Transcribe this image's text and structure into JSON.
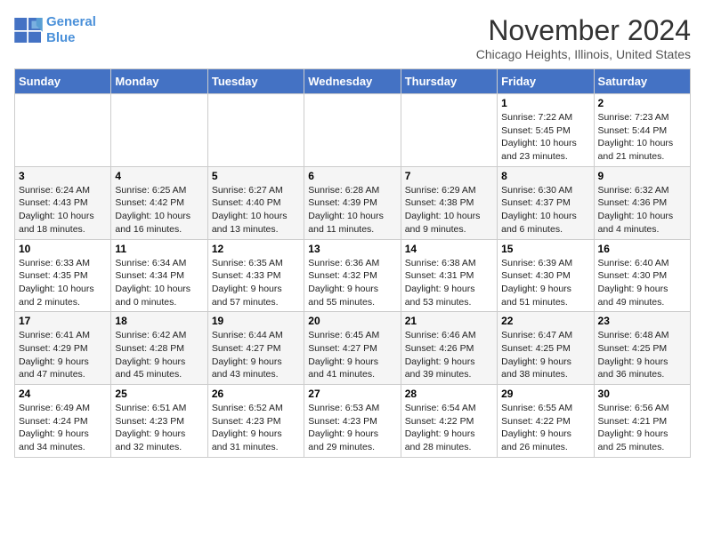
{
  "header": {
    "logo_line1": "General",
    "logo_line2": "Blue",
    "month_title": "November 2024",
    "location": "Chicago Heights, Illinois, United States"
  },
  "weekdays": [
    "Sunday",
    "Monday",
    "Tuesday",
    "Wednesday",
    "Thursday",
    "Friday",
    "Saturday"
  ],
  "weeks": [
    [
      {
        "day": "",
        "info": ""
      },
      {
        "day": "",
        "info": ""
      },
      {
        "day": "",
        "info": ""
      },
      {
        "day": "",
        "info": ""
      },
      {
        "day": "",
        "info": ""
      },
      {
        "day": "1",
        "info": "Sunrise: 7:22 AM\nSunset: 5:45 PM\nDaylight: 10 hours\nand 23 minutes."
      },
      {
        "day": "2",
        "info": "Sunrise: 7:23 AM\nSunset: 5:44 PM\nDaylight: 10 hours\nand 21 minutes."
      }
    ],
    [
      {
        "day": "3",
        "info": "Sunrise: 6:24 AM\nSunset: 4:43 PM\nDaylight: 10 hours\nand 18 minutes."
      },
      {
        "day": "4",
        "info": "Sunrise: 6:25 AM\nSunset: 4:42 PM\nDaylight: 10 hours\nand 16 minutes."
      },
      {
        "day": "5",
        "info": "Sunrise: 6:27 AM\nSunset: 4:40 PM\nDaylight: 10 hours\nand 13 minutes."
      },
      {
        "day": "6",
        "info": "Sunrise: 6:28 AM\nSunset: 4:39 PM\nDaylight: 10 hours\nand 11 minutes."
      },
      {
        "day": "7",
        "info": "Sunrise: 6:29 AM\nSunset: 4:38 PM\nDaylight: 10 hours\nand 9 minutes."
      },
      {
        "day": "8",
        "info": "Sunrise: 6:30 AM\nSunset: 4:37 PM\nDaylight: 10 hours\nand 6 minutes."
      },
      {
        "day": "9",
        "info": "Sunrise: 6:32 AM\nSunset: 4:36 PM\nDaylight: 10 hours\nand 4 minutes."
      }
    ],
    [
      {
        "day": "10",
        "info": "Sunrise: 6:33 AM\nSunset: 4:35 PM\nDaylight: 10 hours\nand 2 minutes."
      },
      {
        "day": "11",
        "info": "Sunrise: 6:34 AM\nSunset: 4:34 PM\nDaylight: 10 hours\nand 0 minutes."
      },
      {
        "day": "12",
        "info": "Sunrise: 6:35 AM\nSunset: 4:33 PM\nDaylight: 9 hours\nand 57 minutes."
      },
      {
        "day": "13",
        "info": "Sunrise: 6:36 AM\nSunset: 4:32 PM\nDaylight: 9 hours\nand 55 minutes."
      },
      {
        "day": "14",
        "info": "Sunrise: 6:38 AM\nSunset: 4:31 PM\nDaylight: 9 hours\nand 53 minutes."
      },
      {
        "day": "15",
        "info": "Sunrise: 6:39 AM\nSunset: 4:30 PM\nDaylight: 9 hours\nand 51 minutes."
      },
      {
        "day": "16",
        "info": "Sunrise: 6:40 AM\nSunset: 4:30 PM\nDaylight: 9 hours\nand 49 minutes."
      }
    ],
    [
      {
        "day": "17",
        "info": "Sunrise: 6:41 AM\nSunset: 4:29 PM\nDaylight: 9 hours\nand 47 minutes."
      },
      {
        "day": "18",
        "info": "Sunrise: 6:42 AM\nSunset: 4:28 PM\nDaylight: 9 hours\nand 45 minutes."
      },
      {
        "day": "19",
        "info": "Sunrise: 6:44 AM\nSunset: 4:27 PM\nDaylight: 9 hours\nand 43 minutes."
      },
      {
        "day": "20",
        "info": "Sunrise: 6:45 AM\nSunset: 4:27 PM\nDaylight: 9 hours\nand 41 minutes."
      },
      {
        "day": "21",
        "info": "Sunrise: 6:46 AM\nSunset: 4:26 PM\nDaylight: 9 hours\nand 39 minutes."
      },
      {
        "day": "22",
        "info": "Sunrise: 6:47 AM\nSunset: 4:25 PM\nDaylight: 9 hours\nand 38 minutes."
      },
      {
        "day": "23",
        "info": "Sunrise: 6:48 AM\nSunset: 4:25 PM\nDaylight: 9 hours\nand 36 minutes."
      }
    ],
    [
      {
        "day": "24",
        "info": "Sunrise: 6:49 AM\nSunset: 4:24 PM\nDaylight: 9 hours\nand 34 minutes."
      },
      {
        "day": "25",
        "info": "Sunrise: 6:51 AM\nSunset: 4:23 PM\nDaylight: 9 hours\nand 32 minutes."
      },
      {
        "day": "26",
        "info": "Sunrise: 6:52 AM\nSunset: 4:23 PM\nDaylight: 9 hours\nand 31 minutes."
      },
      {
        "day": "27",
        "info": "Sunrise: 6:53 AM\nSunset: 4:23 PM\nDaylight: 9 hours\nand 29 minutes."
      },
      {
        "day": "28",
        "info": "Sunrise: 6:54 AM\nSunset: 4:22 PM\nDaylight: 9 hours\nand 28 minutes."
      },
      {
        "day": "29",
        "info": "Sunrise: 6:55 AM\nSunset: 4:22 PM\nDaylight: 9 hours\nand 26 minutes."
      },
      {
        "day": "30",
        "info": "Sunrise: 6:56 AM\nSunset: 4:21 PM\nDaylight: 9 hours\nand 25 minutes."
      }
    ]
  ]
}
